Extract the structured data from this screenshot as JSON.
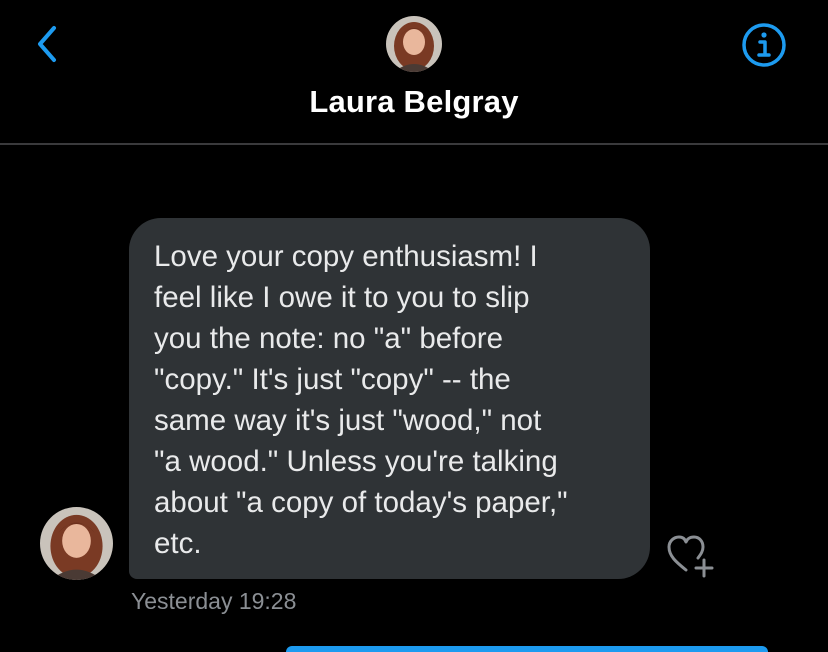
{
  "header": {
    "back_icon": "chevron-left-icon",
    "info_icon": "info-icon",
    "contact_name": "Laura Belgray",
    "accent_color": "#1d9bf0"
  },
  "conversation": {
    "messages": [
      {
        "sender": "Laura Belgray",
        "text": "Love your copy enthusiasm! I\nfeel like I owe it to you to slip\nyou the note: no \"a\" before\n\"copy.\" It's just \"copy\" -- the\nsame way it's just \"wood,\" not\n\"a wood.\" Unless you're talking\nabout \"a copy of today's paper,\"\netc.",
        "timestamp": "Yesterday 19:28",
        "reaction_icon": "heart-plus-icon"
      }
    ]
  }
}
